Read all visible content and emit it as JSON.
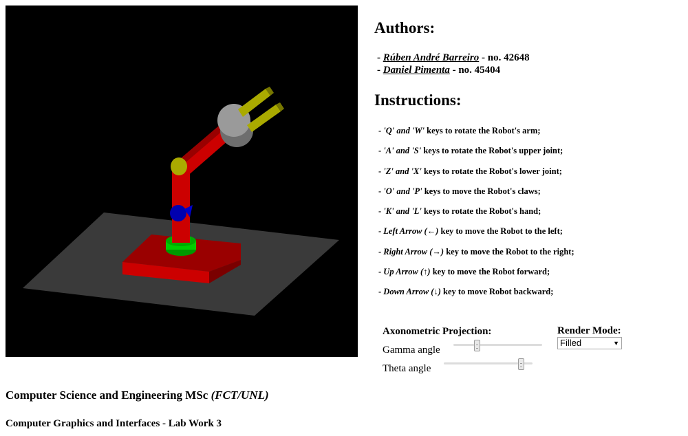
{
  "authors": {
    "heading": "Authors:",
    "list": [
      {
        "name": "Rúben André Barreiro",
        "number": "- no. 42648"
      },
      {
        "name": "Daniel Pimenta",
        "number": "- no. 45404"
      }
    ]
  },
  "instructions": {
    "heading": "Instructions:",
    "items": [
      {
        "keys": "'Q' and 'W'",
        "text": "keys to rotate the Robot's arm;"
      },
      {
        "keys": "'A' and 'S'",
        "text": "keys to rotate the Robot's upper joint;"
      },
      {
        "keys": "'Z' and 'X'",
        "text": "keys to rotate the Robot's lower joint;"
      },
      {
        "keys": "'O' and 'P'",
        "text": "keys to move the Robot's claws;"
      },
      {
        "keys": "'K' and 'L'",
        "text": "keys to rotate the Robot's hand;"
      },
      {
        "keys": "Left Arrow (←)",
        "text": "key to move the Robot to the left;"
      },
      {
        "keys": "Right Arrow (→)",
        "text": "key to move the Robot to the right;"
      },
      {
        "keys": "Up Arrow (↑)",
        "text": "key to move the Robot forward;"
      },
      {
        "keys": "Down Arrow (↓)",
        "text": "key to move Robot backward;"
      }
    ]
  },
  "projection": {
    "heading": "Axonometric Projection:",
    "gamma_label": "Gamma angle",
    "gamma_value": 0.25,
    "theta_label": "Theta angle",
    "theta_value": 0.9
  },
  "render_mode": {
    "heading": "Render Mode:",
    "selected": "Filled"
  },
  "footer": {
    "course": "Computer Science and Engineering MSc",
    "institution": "(FCT/UNL)",
    "lab": "Computer Graphics and Interfaces - Lab Work 3"
  },
  "scene": {
    "background": "#000000",
    "floor": "#3a3a3a",
    "base": "#b30000",
    "ring": "#00b300",
    "joint_lower": "#0000aa",
    "joint_upper": "#aaaa00",
    "hand": "#9a9a9a",
    "claws": "#aaaa00"
  }
}
